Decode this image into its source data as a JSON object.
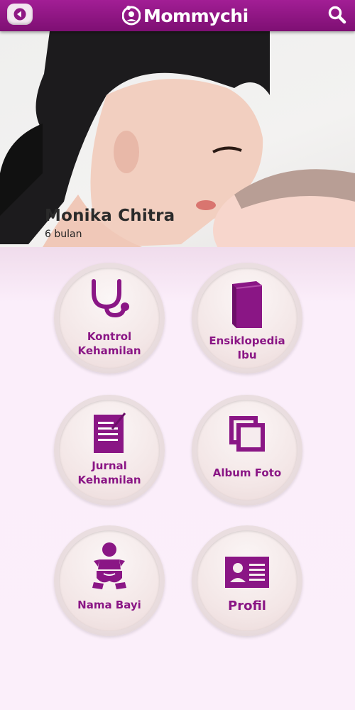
{
  "header": {
    "app_name": "Mommychi",
    "back_icon": "back-arrow-icon",
    "search_icon": "search-icon",
    "brand_color": "#8f1784"
  },
  "profile": {
    "name": "Monika Chitra",
    "age": "6 bulan"
  },
  "menu": {
    "items": [
      {
        "label_1": "Kontrol",
        "label_2": "Kehamilan",
        "icon": "stethoscope-icon"
      },
      {
        "label_1": "Ensiklopedia",
        "label_2": "Ibu",
        "icon": "book-icon"
      },
      {
        "label_1": "Jurnal",
        "label_2": "Kehamilan",
        "icon": "journal-icon"
      },
      {
        "label_1": "Album Foto",
        "label_2": "",
        "icon": "photo-album-icon"
      },
      {
        "label_1": "Nama Bayi",
        "label_2": "",
        "icon": "baby-icon"
      },
      {
        "label_1": "Profil",
        "label_2": "",
        "icon": "profile-card-icon"
      }
    ],
    "accent_color": "#8a1685"
  }
}
